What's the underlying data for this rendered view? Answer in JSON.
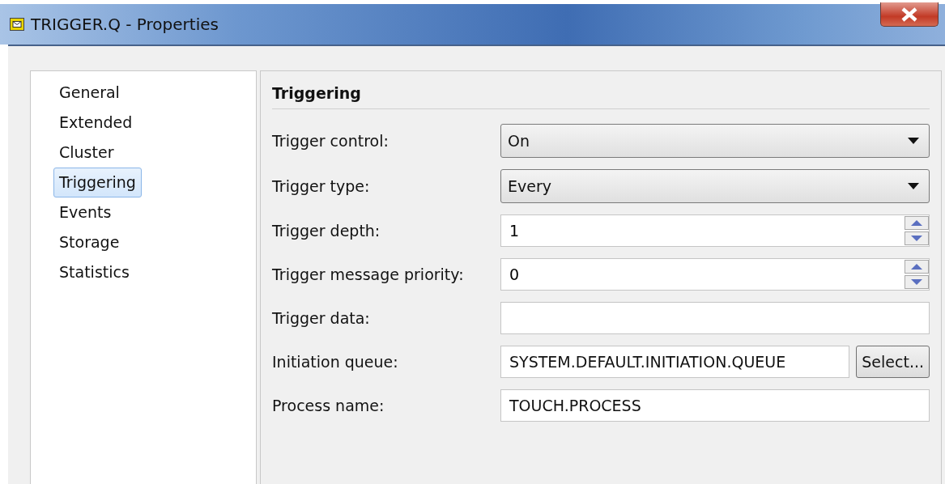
{
  "window": {
    "title": "TRIGGER.Q - Properties"
  },
  "nav": [
    {
      "label": "General",
      "selected": false
    },
    {
      "label": "Extended",
      "selected": false
    },
    {
      "label": "Cluster",
      "selected": false
    },
    {
      "label": "Triggering",
      "selected": true
    },
    {
      "label": "Events",
      "selected": false
    },
    {
      "label": "Storage",
      "selected": false
    },
    {
      "label": "Statistics",
      "selected": false
    }
  ],
  "section": {
    "title": "Triggering"
  },
  "fields": [
    {
      "kind": "dropdown",
      "label": "Trigger control:",
      "value": "On"
    },
    {
      "kind": "dropdown",
      "label": "Trigger type:",
      "value": "Every"
    },
    {
      "kind": "spinner",
      "label": "Trigger depth:",
      "value": "1"
    },
    {
      "kind": "spinner",
      "label": "Trigger message priority:",
      "value": "0"
    },
    {
      "kind": "text",
      "label": "Trigger data:"
    },
    {
      "kind": "text-button",
      "label": "Initiation queue:",
      "value": "SYSTEM.DEFAULT.INITIATION.QUEUE",
      "button": "Select..."
    },
    {
      "kind": "text",
      "label": "Process name:",
      "value": "TOUCH.PROCESS"
    }
  ]
}
